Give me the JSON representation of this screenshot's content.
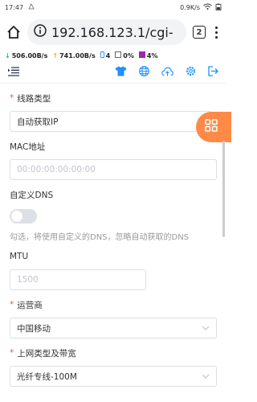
{
  "status_bar": {
    "time": "17:47",
    "speed": "0.9K/s"
  },
  "browser": {
    "url": "192.168.123.1/cgi-",
    "tab_count": "2"
  },
  "metrics": {
    "download": "506.00B/s",
    "upload": "741.00B/s",
    "devices": "4",
    "cpu": "0%",
    "mem": "4%"
  },
  "form": {
    "line_type": {
      "label": "线路类型",
      "value": "自动获取IP"
    },
    "mac": {
      "label": "MAC地址",
      "placeholder": "00:00:00:00:00:00"
    },
    "dns": {
      "label": "自定义DNS",
      "hint": "勾选，将使用自定义的DNS，忽略自动获取的DNS",
      "enabled": false
    },
    "mtu": {
      "label": "MTU",
      "placeholder": "1500"
    },
    "isp": {
      "label": "运营商",
      "value": "中国移动"
    },
    "net_type": {
      "label": "上网类型及带宽",
      "value": "光纤专线-100M"
    }
  },
  "colors": {
    "accent": "#1e90ff",
    "fab": "#ff8a48",
    "required": "#ff4d4f"
  },
  "icons": [
    "home-icon",
    "info-icon",
    "tabs-icon",
    "more-icon",
    "menu-collapse-icon",
    "shirt-icon",
    "globe-icon",
    "cloud-upload-icon",
    "gear-icon",
    "logout-icon",
    "grid-icon",
    "chevron-down-icon"
  ]
}
